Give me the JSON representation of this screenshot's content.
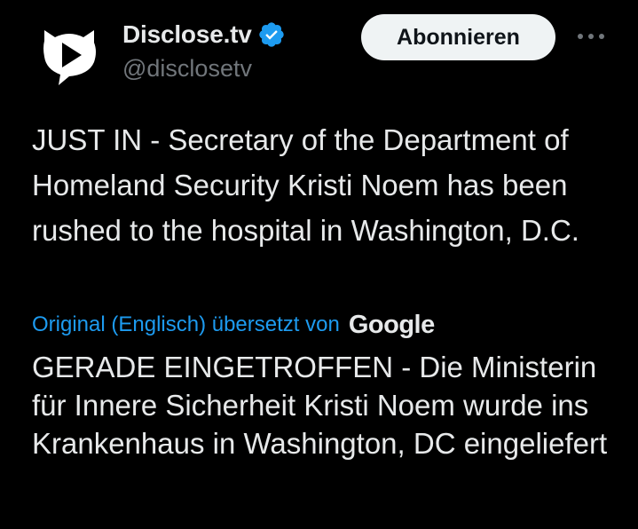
{
  "author": {
    "display_name": "Disclose.tv",
    "handle": "@disclosetv",
    "verified_icon": "verified-badge-icon",
    "avatar_icon": "disclose-tv-logo-icon"
  },
  "actions": {
    "follow_label": "Abonnieren",
    "more_icon": "more-horizontal-icon"
  },
  "tweet": {
    "text": "JUST IN - Secretary of the Department of Homeland Security Kristi Noem has been rushed to the hospital in Washington, D.C."
  },
  "translation": {
    "note": "Original (Englisch) übersetzt von",
    "provider": "Google",
    "text": "GERADE EINGETROFFEN - Die Ministerin für Innere Sicherheit Kristi Noem wurde ins Krankenhaus in Washington, DC eingeliefert"
  },
  "colors": {
    "background": "#000000",
    "text_primary": "#e7e9ea",
    "text_secondary": "#71767b",
    "accent_blue": "#1d9bf0",
    "button_bg": "#eff3f4"
  }
}
